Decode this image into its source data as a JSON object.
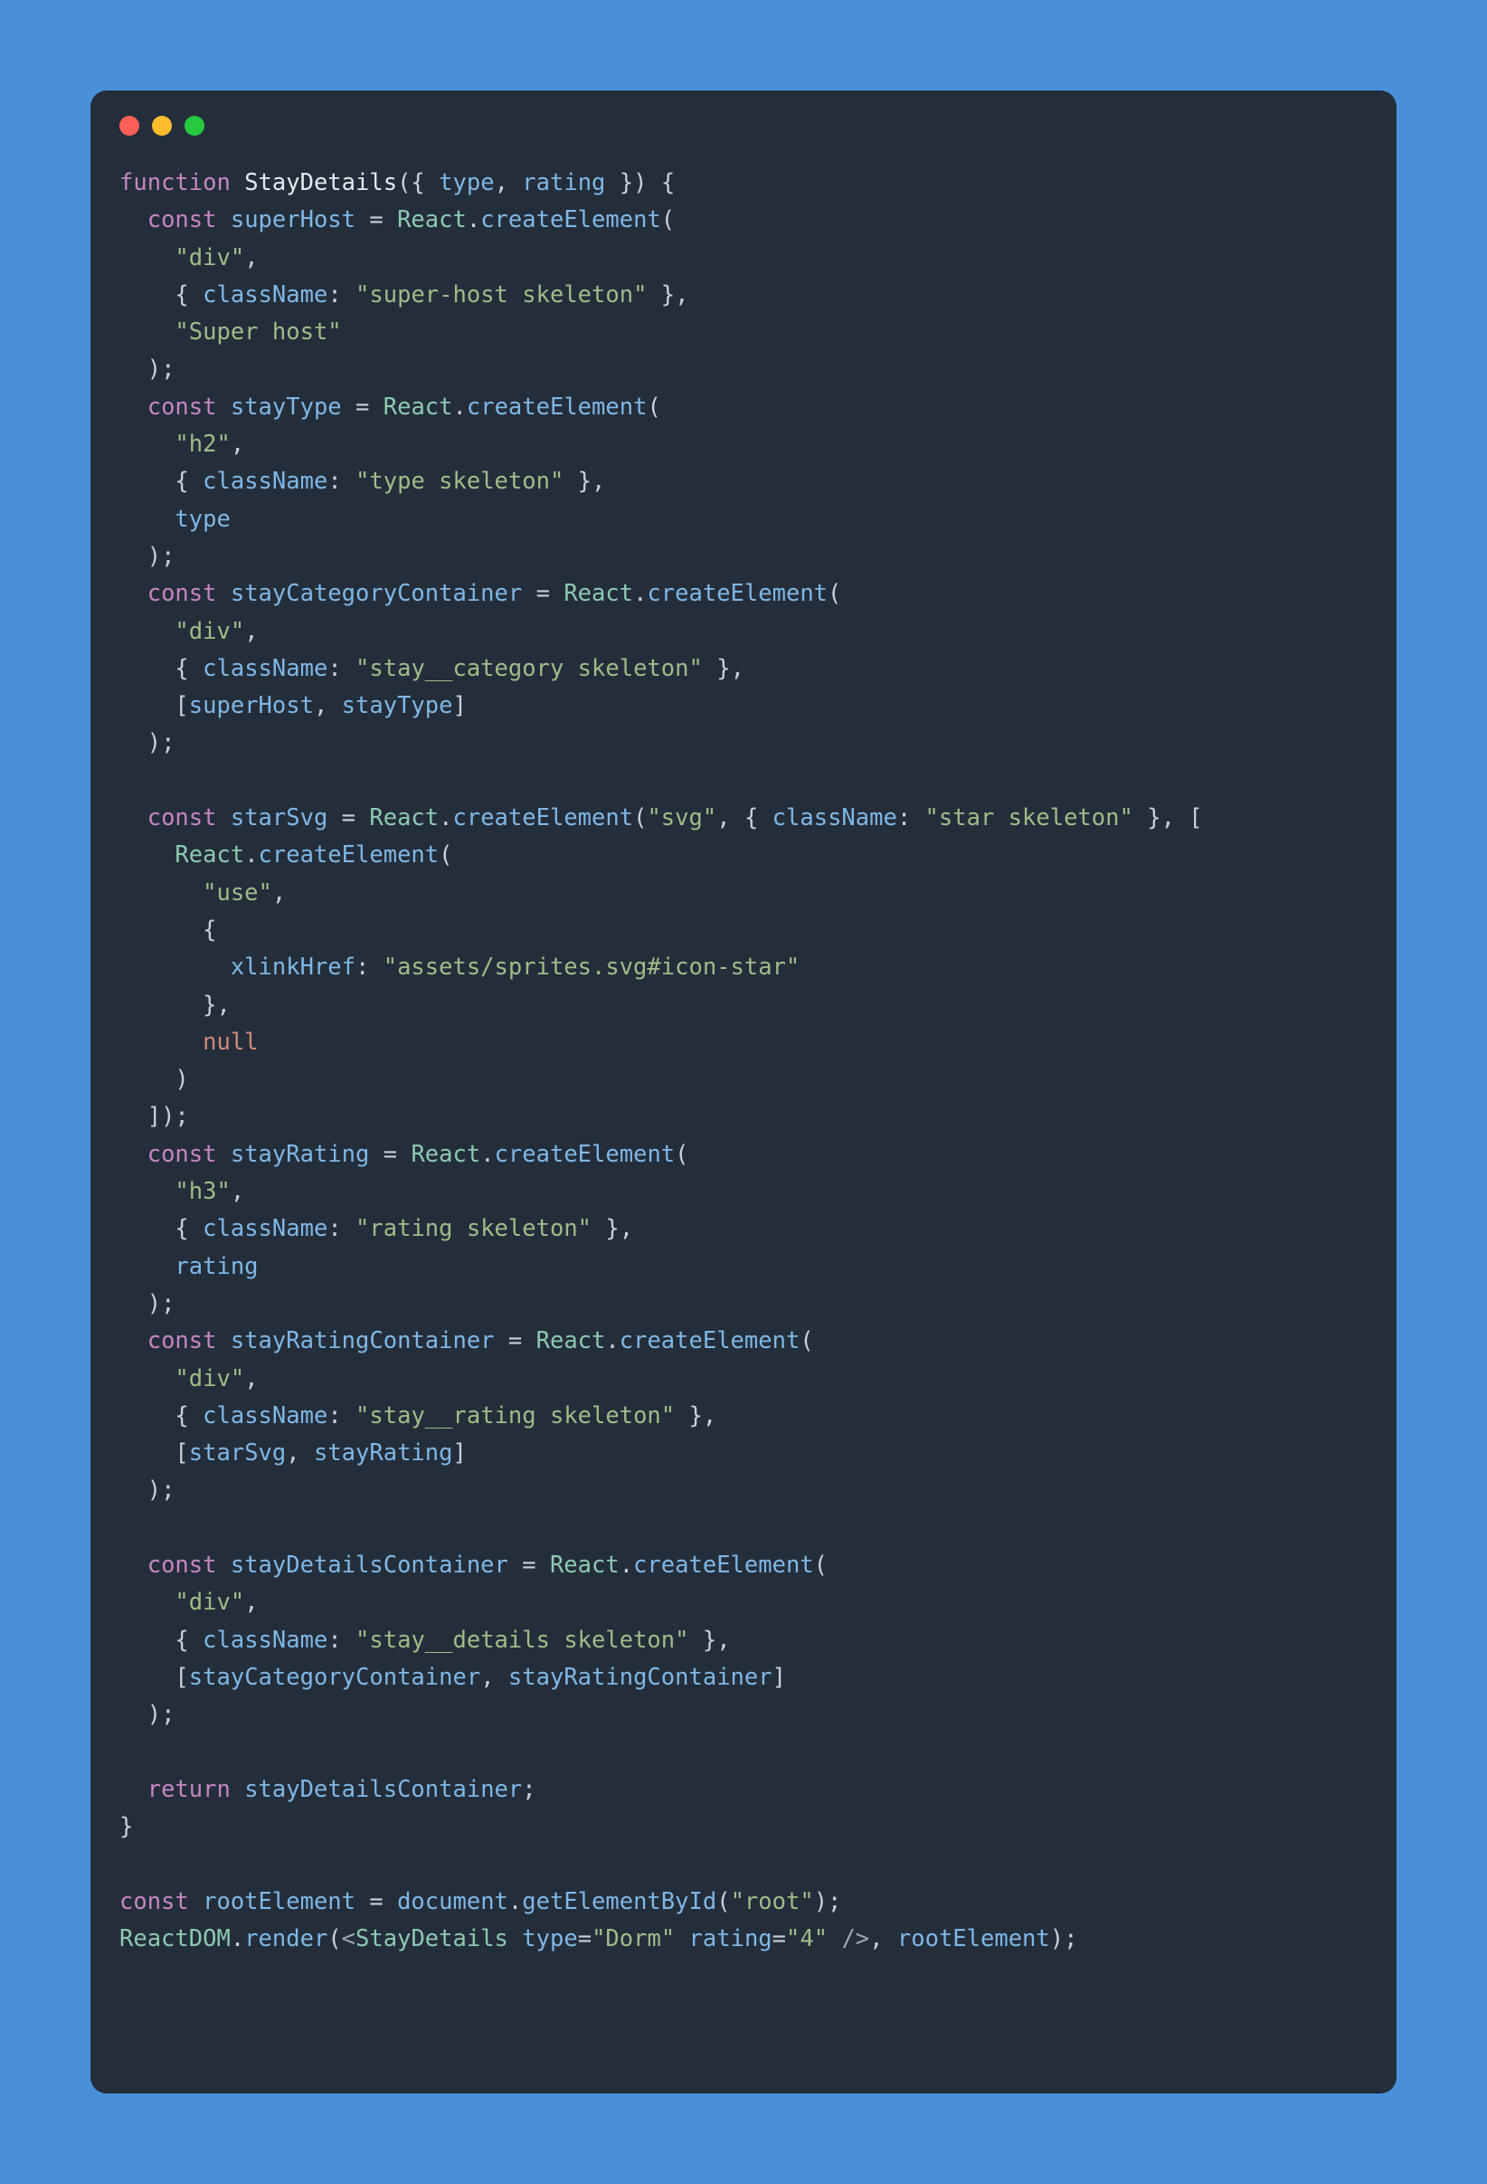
{
  "code": {
    "line1": {
      "kw": "function",
      "fn": "StayDetails",
      "p1": "({ ",
      "a1": "type",
      "c1": ", ",
      "a2": "rating",
      "p2": " }) {"
    },
    "line2": {
      "indent": "  ",
      "kw": "const",
      "sp": " ",
      "var": "superHost",
      "eq": " = ",
      "cls": "React",
      "dot": ".",
      "meth": "createElement",
      "p": "("
    },
    "line3": {
      "indent": "    ",
      "str": "\"div\"",
      "c": ","
    },
    "line4": {
      "indent": "    ",
      "b1": "{ ",
      "prop": "className",
      "col": ": ",
      "str": "\"super-host skeleton\"",
      "b2": " }",
      "c": ","
    },
    "line5": {
      "indent": "    ",
      "str": "\"Super host\""
    },
    "line6": {
      "indent": "  ",
      "p": ");"
    },
    "line7": {
      "indent": "  ",
      "kw": "const",
      "sp": " ",
      "var": "stayType",
      "eq": " = ",
      "cls": "React",
      "dot": ".",
      "meth": "createElement",
      "p": "("
    },
    "line8": {
      "indent": "    ",
      "str": "\"h2\"",
      "c": ","
    },
    "line9": {
      "indent": "    ",
      "b1": "{ ",
      "prop": "className",
      "col": ": ",
      "str": "\"type skeleton\"",
      "b2": " }",
      "c": ","
    },
    "line10": {
      "indent": "    ",
      "var": "type"
    },
    "line11": {
      "indent": "  ",
      "p": ");"
    },
    "line12": {
      "indent": "  ",
      "kw": "const",
      "sp": " ",
      "var": "stayCategoryContainer",
      "eq": " = ",
      "cls": "React",
      "dot": ".",
      "meth": "createElement",
      "p": "("
    },
    "line13": {
      "indent": "    ",
      "str": "\"div\"",
      "c": ","
    },
    "line14": {
      "indent": "    ",
      "b1": "{ ",
      "prop": "className",
      "col": ": ",
      "str": "\"stay__category skeleton\"",
      "b2": " }",
      "c": ","
    },
    "line15": {
      "indent": "    ",
      "b1": "[",
      "v1": "superHost",
      "c1": ", ",
      "v2": "stayType",
      "b2": "]"
    },
    "line16": {
      "indent": "  ",
      "p": ");"
    },
    "blank1": "",
    "line17": {
      "indent": "  ",
      "kw": "const",
      "sp": " ",
      "var": "starSvg",
      "eq": " = ",
      "cls": "React",
      "dot": ".",
      "meth": "createElement",
      "p1": "(",
      "str1": "\"svg\"",
      "c1": ", ",
      "b1": "{ ",
      "prop": "className",
      "col": ": ",
      "str2": "\"star skeleton\"",
      "b2": " }",
      "c2": ", ["
    },
    "line18": {
      "indent": "    ",
      "cls": "React",
      "dot": ".",
      "meth": "createElement",
      "p": "("
    },
    "line19": {
      "indent": "      ",
      "str": "\"use\"",
      "c": ","
    },
    "line20": {
      "indent": "      ",
      "b": "{"
    },
    "line21": {
      "indent": "        ",
      "prop": "xlinkHref",
      "col": ": ",
      "str": "\"assets/sprites.svg#icon-star\""
    },
    "line22": {
      "indent": "      ",
      "b": "}",
      "c": ","
    },
    "line23": {
      "indent": "      ",
      "null": "null"
    },
    "line24": {
      "indent": "    ",
      "p": ")"
    },
    "line25": {
      "indent": "  ",
      "p": "]);"
    },
    "line26": {
      "indent": "  ",
      "kw": "const",
      "sp": " ",
      "var": "stayRating",
      "eq": " = ",
      "cls": "React",
      "dot": ".",
      "meth": "createElement",
      "p": "("
    },
    "line27": {
      "indent": "    ",
      "str": "\"h3\"",
      "c": ","
    },
    "line28": {
      "indent": "    ",
      "b1": "{ ",
      "prop": "className",
      "col": ": ",
      "str": "\"rating skeleton\"",
      "b2": " }",
      "c": ","
    },
    "line29": {
      "indent": "    ",
      "var": "rating"
    },
    "line30": {
      "indent": "  ",
      "p": ");"
    },
    "line31": {
      "indent": "  ",
      "kw": "const",
      "sp": " ",
      "var": "stayRatingContainer",
      "eq": " = ",
      "cls": "React",
      "dot": ".",
      "meth": "createElement",
      "p": "("
    },
    "line32": {
      "indent": "    ",
      "str": "\"div\"",
      "c": ","
    },
    "line33": {
      "indent": "    ",
      "b1": "{ ",
      "prop": "className",
      "col": ": ",
      "str": "\"stay__rating skeleton\"",
      "b2": " }",
      "c": ","
    },
    "line34": {
      "indent": "    ",
      "b1": "[",
      "v1": "starSvg",
      "c1": ", ",
      "v2": "stayRating",
      "b2": "]"
    },
    "line35": {
      "indent": "  ",
      "p": ");"
    },
    "blank2": "",
    "line36": {
      "indent": "  ",
      "kw": "const",
      "sp": " ",
      "var": "stayDetailsContainer",
      "eq": " = ",
      "cls": "React",
      "dot": ".",
      "meth": "createElement",
      "p": "("
    },
    "line37": {
      "indent": "    ",
      "str": "\"div\"",
      "c": ","
    },
    "line38": {
      "indent": "    ",
      "b1": "{ ",
      "prop": "className",
      "col": ": ",
      "str": "\"stay__details skeleton\"",
      "b2": " }",
      "c": ","
    },
    "line39": {
      "indent": "    ",
      "b1": "[",
      "v1": "stayCategoryContainer",
      "c1": ", ",
      "v2": "stayRatingContainer",
      "b2": "]"
    },
    "line40": {
      "indent": "  ",
      "p": ");"
    },
    "blank3": "",
    "line41": {
      "indent": "  ",
      "kw": "return",
      "sp": " ",
      "var": "stayDetailsContainer",
      "p": ";"
    },
    "line42": {
      "p": "}"
    },
    "blank4": "",
    "line43": {
      "kw": "const",
      "sp": " ",
      "var": "rootElement",
      "eq": " = ",
      "obj": "document",
      "dot": ".",
      "meth": "getElementById",
      "p1": "(",
      "str": "\"root\"",
      "p2": ");"
    },
    "line44": {
      "cls": "ReactDOM",
      "dot": ".",
      "meth": "render",
      "p1": "(",
      "a1": "<",
      "tag": "StayDetails",
      "sp1": " ",
      "attr1": "type",
      "eq1": "=",
      "str1": "\"Dorm\"",
      "sp2": " ",
      "attr2": "rating",
      "eq2": "=",
      "str2": "\"4\"",
      "sp3": " ",
      "a2": "/>",
      "c": ", ",
      "var": "rootElement",
      "p2": ");"
    }
  }
}
